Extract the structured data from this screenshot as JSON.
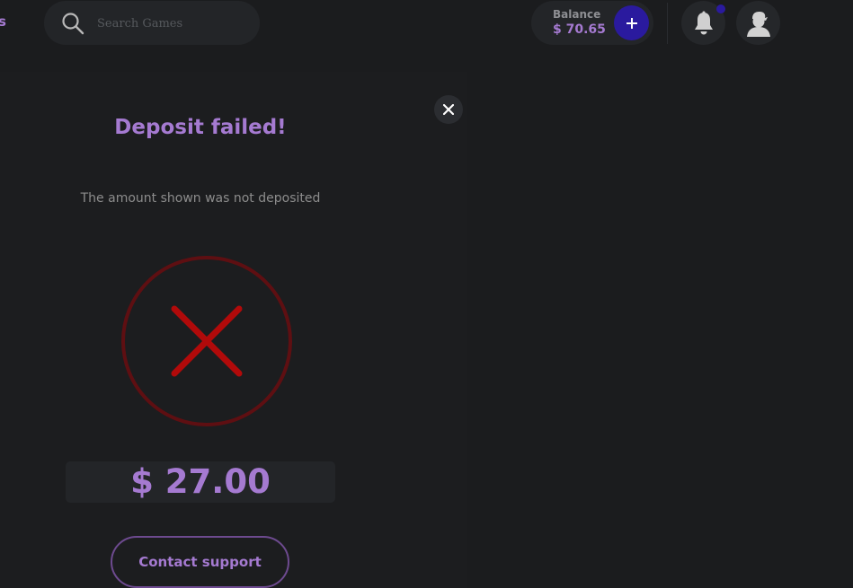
{
  "header": {
    "nav_fragment": "s",
    "search": {
      "placeholder": "Search Games",
      "icon": "search-icon"
    },
    "balance": {
      "label": "Balance",
      "amount": "$ 70.65",
      "add_icon": "plus-icon"
    },
    "notifications": {
      "icon": "bell-icon",
      "has_unread": true
    },
    "profile": {
      "icon": "user-avatar-icon"
    }
  },
  "modal": {
    "title": "Deposit failed!",
    "subtitle": "The amount shown was not deposited",
    "status_icon": "failure-x-icon",
    "amount": "$ 27.00",
    "support_label": "Contact support",
    "close_icon": "close-icon"
  },
  "colors": {
    "background": "#1b1c1e",
    "accent": "#a57ad1",
    "primary_button": "#2a1a9e",
    "error": "#b10a0a",
    "error_ring": "#5e0f12"
  }
}
